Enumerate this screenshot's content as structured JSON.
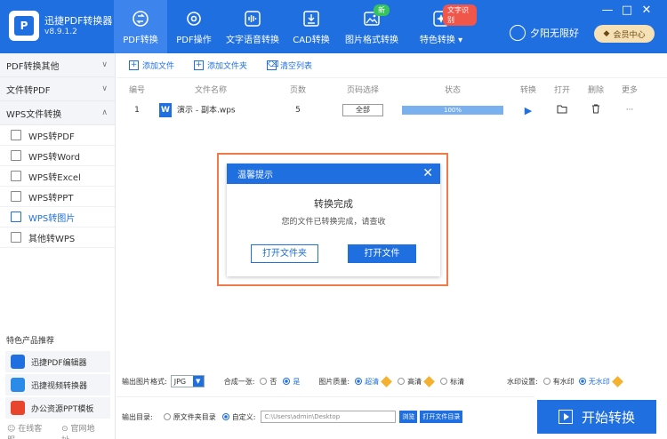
{
  "app": {
    "name": "迅捷PDF转换器",
    "version": "v8.9.1.2"
  },
  "nav": [
    {
      "label": "PDF转换",
      "icon": "refresh-icon",
      "active": true
    },
    {
      "label": "PDF操作",
      "icon": "gear-icon"
    },
    {
      "label": "文字语音转换",
      "icon": "audio-icon"
    },
    {
      "label": "CAD转换",
      "icon": "cad-icon"
    },
    {
      "label": "图片格式转换",
      "icon": "image-icon",
      "badge": "新"
    },
    {
      "label": "特色转换",
      "icon": "sparkle-icon",
      "badge": "文字识别"
    }
  ],
  "user": {
    "name": "夕阳无限好",
    "vip_label": "会员中心"
  },
  "window_controls": [
    "—",
    "□",
    "✕"
  ],
  "sidebar": {
    "groups": [
      {
        "label": "PDF转换其他",
        "chevron": "∨"
      },
      {
        "label": "文件转PDF",
        "chevron": "∨"
      },
      {
        "label": "WPS文件转换",
        "chevron": "∧"
      }
    ],
    "items": [
      {
        "label": "WPS转PDF"
      },
      {
        "label": "WPS转Word"
      },
      {
        "label": "WPS转Excel"
      },
      {
        "label": "WPS转PPT"
      },
      {
        "label": "WPS转图片",
        "active": true
      },
      {
        "label": "其他转WPS"
      }
    ],
    "recommend_title": "特色产品推荐",
    "recommend": [
      {
        "label": "迅捷PDF编辑器",
        "color": "#1f6fe0"
      },
      {
        "label": "迅捷视频转换器",
        "color": "#2b8be8"
      },
      {
        "label": "办公资源PPT模板",
        "color": "#e8452c"
      }
    ],
    "footer": {
      "service": "在线客服",
      "site": "官网地址"
    }
  },
  "toolbar": {
    "add_file": "添加文件",
    "add_folder": "添加文件夹",
    "clear": "清空列表"
  },
  "table": {
    "headers": [
      "编号",
      "文件名称",
      "页数",
      "页码选择",
      "状态",
      "转换",
      "打开",
      "删除",
      "更多"
    ],
    "rows": [
      {
        "index": "1",
        "name": "演示 - 副本.wps",
        "pages": "5",
        "range": "全部",
        "progress": 100,
        "progress_label": "100%",
        "file_icon": "W"
      }
    ]
  },
  "dialog": {
    "header": "温馨提示",
    "title": "转换完成",
    "message": "您的文件已转换完成，请查收",
    "open_folder": "打开文件夹",
    "open_file": "打开文件"
  },
  "settings": {
    "format_label": "输出图片格式:",
    "format_value": "JPG",
    "merge_label": "合成一张:",
    "merge_no": "否",
    "merge_yes": "是",
    "quality_label": "图片质量:",
    "quality_options": [
      "超清",
      "高清",
      "标清"
    ],
    "watermark_label": "水印设置:",
    "watermark_on": "有水印",
    "watermark_off": "无水印",
    "output_label": "输出目录:",
    "output_original": "原文件夹目录",
    "output_custom": "自定义:",
    "output_path": "C:\\Users\\admin\\Desktop",
    "browse": "浏览",
    "open_dir": "打开文件目录"
  },
  "start_button": "开始转换",
  "colors": {
    "primary": "#1f6fe0",
    "highlight": "#f07a4a",
    "vip_bg": "#f6e1b6"
  }
}
